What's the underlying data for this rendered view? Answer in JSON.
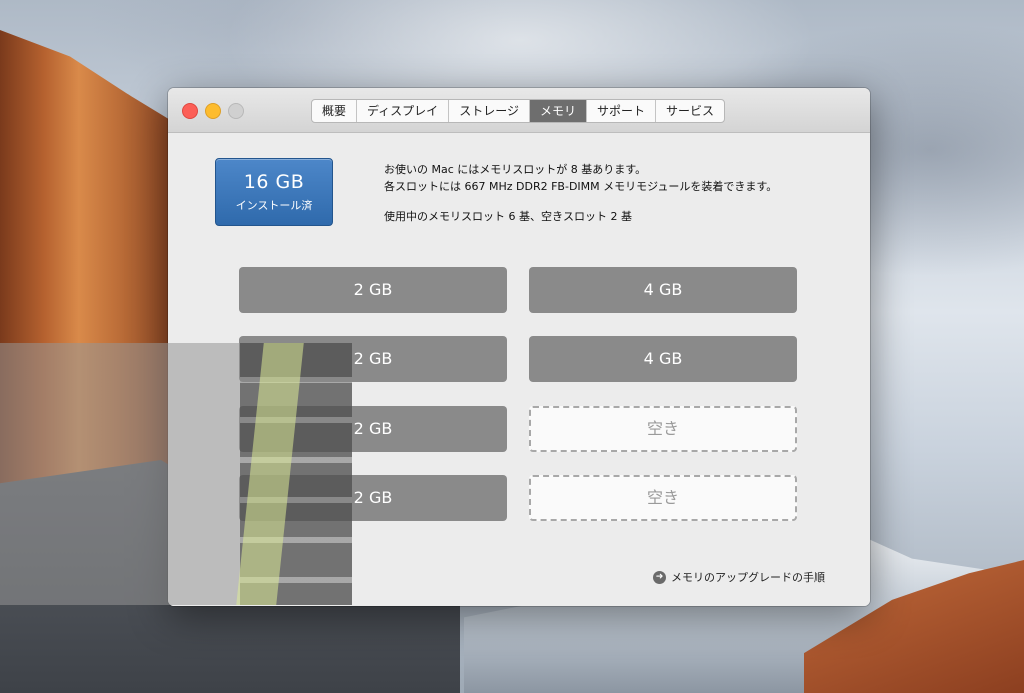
{
  "window": {
    "tabs": [
      {
        "label": "概要"
      },
      {
        "label": "ディスプレイ"
      },
      {
        "label": "ストレージ"
      },
      {
        "label": "メモリ",
        "active": true
      },
      {
        "label": "サポート"
      },
      {
        "label": "サービス"
      }
    ]
  },
  "memory": {
    "total_size": "16 GB",
    "total_label": "インストール済",
    "info_line1": "お使いの Mac にはメモリスロットが 8 基あります。",
    "info_line2": "各スロットには 667 MHz DDR2 FB-DIMM メモリモジュールを装着できます。",
    "info_line3": "使用中のメモリスロット 6 基、空きスロット 2 基",
    "slots": [
      {
        "label": "2 GB",
        "state": "filled"
      },
      {
        "label": "4 GB",
        "state": "filled"
      },
      {
        "label": "2 GB",
        "state": "filled"
      },
      {
        "label": "4 GB",
        "state": "filled"
      },
      {
        "label": "2 GB",
        "state": "filled"
      },
      {
        "label": "空き",
        "state": "empty"
      },
      {
        "label": "2 GB",
        "state": "filled"
      },
      {
        "label": "空き",
        "state": "empty"
      }
    ],
    "upgrade_link": "メモリのアップグレードの手順"
  },
  "colors": {
    "badge_blue": "#2f6aac",
    "slot_filled": "#8a8a8a",
    "active_tab": "#6e6e6e"
  },
  "icons": {
    "upgrade": "arrow-right-circle-icon"
  }
}
